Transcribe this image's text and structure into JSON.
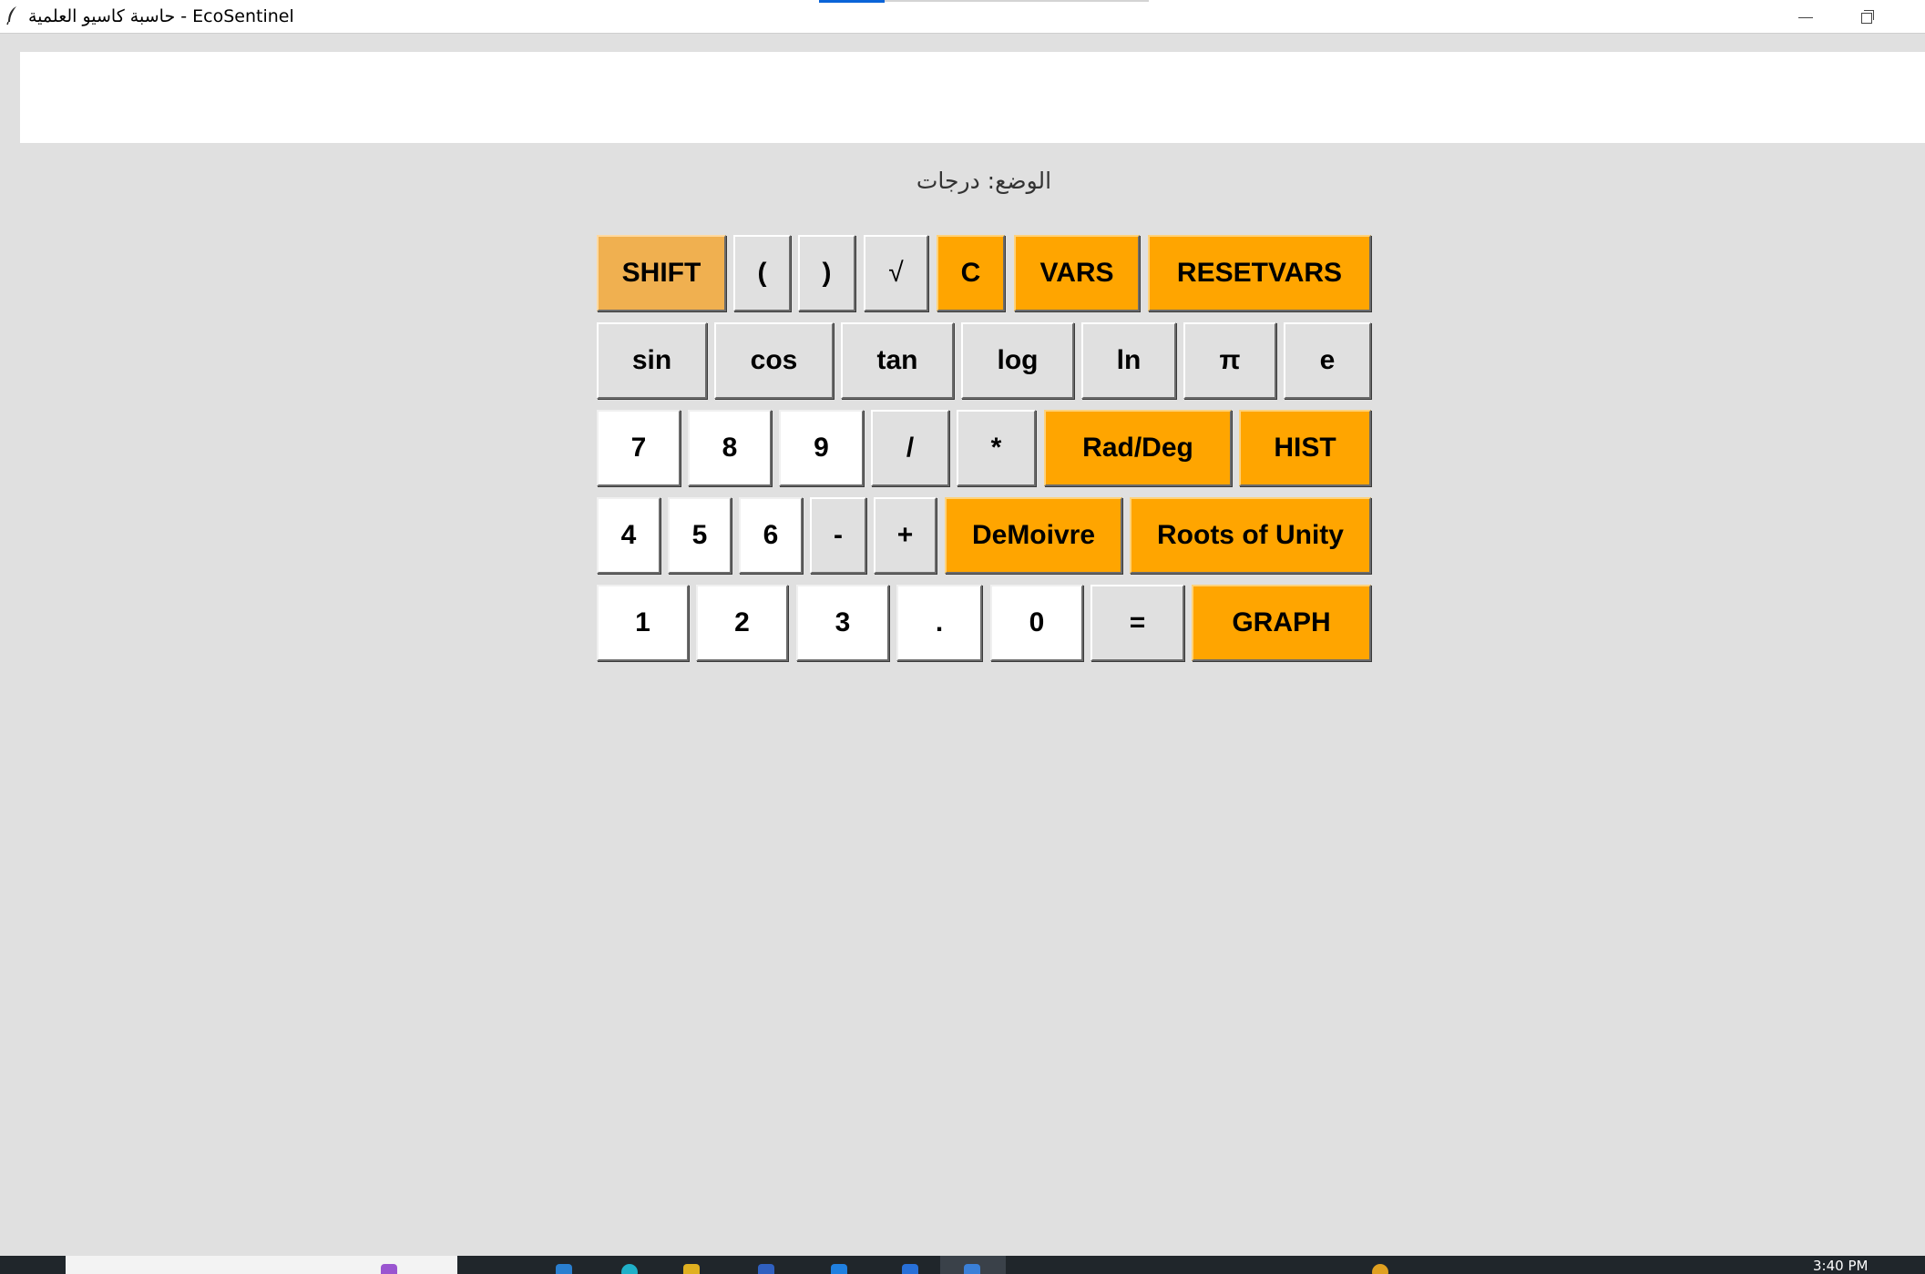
{
  "window": {
    "title": "حاسبة كاسيو العلمية - EcoSentinel",
    "minimize_icon": "minimize-icon",
    "restore_icon": "restore-icon"
  },
  "display": {
    "value": "",
    "placeholder": ""
  },
  "mode_label": "الوضع: درجات",
  "keypad": {
    "row1": {
      "shift": "SHIFT",
      "lparen": "(",
      "rparen": ")",
      "sqrt": "√",
      "clear": "C",
      "vars": "VARS",
      "resetvars": "RESETVARS"
    },
    "row2": {
      "sin": "sin",
      "cos": "cos",
      "tan": "tan",
      "log": "log",
      "ln": "ln",
      "pi": "π",
      "e": "e"
    },
    "row3": {
      "seven": "7",
      "eight": "8",
      "nine": "9",
      "divide": "/",
      "multiply": "*",
      "raddeg": "Rad/Deg",
      "hist": "HIST"
    },
    "row4": {
      "four": "4",
      "five": "5",
      "six": "6",
      "minus": "-",
      "plus": "+",
      "demoivre": "DeMoivre",
      "roots": "Roots of Unity"
    },
    "row5": {
      "one": "1",
      "two": "2",
      "three": "3",
      "dot": ".",
      "zero": "0",
      "equals": "=",
      "graph": "GRAPH"
    }
  },
  "colors": {
    "orange": "#ffa500",
    "shift": "#f0b050",
    "gray": "#e0e0e0",
    "white": "#ffffff",
    "background": "#e0e0e0"
  },
  "taskbar": {
    "clock": "3:40 PM"
  }
}
